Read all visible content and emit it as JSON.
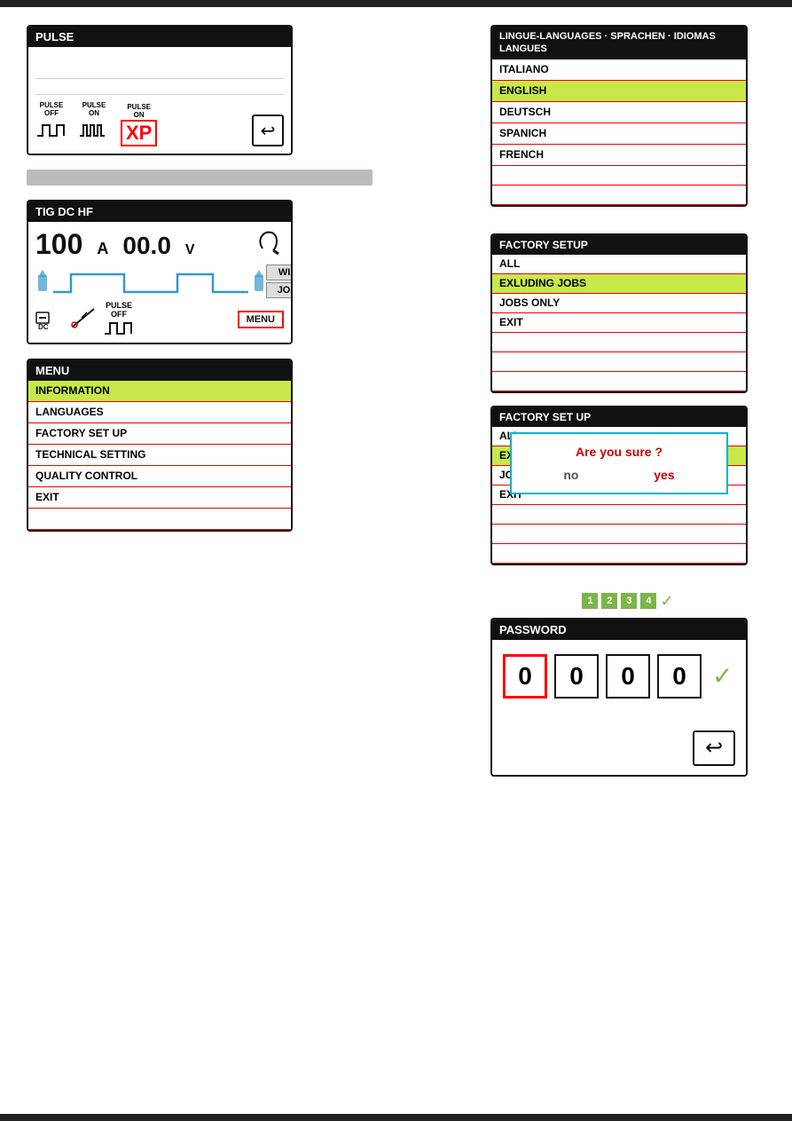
{
  "topBar": {},
  "bottomBar": {},
  "pulse": {
    "header": "PULSE",
    "icons": [
      {
        "label": "PULSE\nOFF",
        "wave": "square_off"
      },
      {
        "label": "PULSE\nON",
        "wave": "square_on"
      },
      {
        "label": "PULSE\nON",
        "wave": "xp",
        "highlight": true
      }
    ]
  },
  "tig": {
    "header": "TIG DC HF",
    "amps": "100",
    "amps_unit": "A",
    "volts": "00.0",
    "volts_unit": "V",
    "wiz_label": "WIZ",
    "job_label": "JOB",
    "menu_label": "MENU",
    "dc_label": "DC",
    "pulse_label": "PULSE\nOFF"
  },
  "menu": {
    "header": "MENU",
    "items": [
      {
        "label": "INFORMATION",
        "active": true
      },
      {
        "label": "LANGUAGES",
        "active": false
      },
      {
        "label": "FACTORY SET UP",
        "active": false
      },
      {
        "label": "TECHNICAL SETTING",
        "active": false
      },
      {
        "label": "QUALITY CONTROL",
        "active": false
      },
      {
        "label": "EXIT",
        "active": false
      }
    ]
  },
  "languages": {
    "header": "LINGUE-LANGUAGES · SPRACHEN · IDIOMAS\nLANGUES",
    "items": [
      {
        "label": "ITALIANO",
        "active": false
      },
      {
        "label": "ENGLISH",
        "active": true
      },
      {
        "label": "DEUTSCH",
        "active": false
      },
      {
        "label": "SPANICH",
        "active": false
      },
      {
        "label": "FRENCH",
        "active": false
      },
      {
        "label": "",
        "active": false
      },
      {
        "label": "",
        "active": false
      }
    ]
  },
  "factorySetup": {
    "header": "FACTORY SETUP",
    "items": [
      {
        "label": "ALL",
        "active": false
      },
      {
        "label": "EXLUDING JOBS",
        "active": true
      },
      {
        "label": "JOBS ONLY",
        "active": false
      },
      {
        "label": "EXIT",
        "active": false
      },
      {
        "label": "",
        "active": false
      },
      {
        "label": "",
        "active": false
      },
      {
        "label": "",
        "active": false
      }
    ]
  },
  "factoryConfirm": {
    "header": "FACTORY SET UP",
    "items": [
      {
        "label": "ALL",
        "active": false
      },
      {
        "label": "EXCLU...",
        "active": true
      },
      {
        "label": "JOBS...",
        "active": false
      },
      {
        "label": "EXIT",
        "active": false
      }
    ],
    "dialog": {
      "question": "Are you sure ?",
      "no_label": "no",
      "yes_label": "yes"
    }
  },
  "passwordSteps": {
    "steps": [
      "1",
      "2",
      "3",
      "4"
    ],
    "check": "✓"
  },
  "password": {
    "header": "PASSWORD",
    "digits": [
      "0",
      "0",
      "0",
      "0"
    ],
    "active_index": 0
  }
}
